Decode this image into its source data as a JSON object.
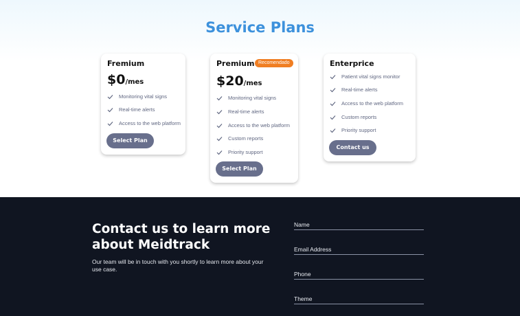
{
  "section_title": "Service Plans",
  "plans": [
    {
      "name": "Fremium",
      "price": "$0",
      "period": "/mes",
      "badge": "",
      "features": [
        "Monitoring vital signs",
        "Real-time alerts",
        "Access to the web platform"
      ],
      "button": "Select Plan"
    },
    {
      "name": "Premium",
      "price": "$20",
      "period": "/mes",
      "badge": "Recomendado",
      "features": [
        "Monitoring vital signs",
        "Real-time alerts",
        "Access to the web platform",
        "Custom reports",
        "Priority support"
      ],
      "button": "Select Plan"
    },
    {
      "name": "Enterprice",
      "price": "",
      "period": "",
      "badge": "",
      "features": [
        "Patient vital signs monitor",
        "Real-time alerts",
        "Access to the web platform",
        "Custom reports",
        "Priority support"
      ],
      "button": "Contact us"
    }
  ],
  "contact": {
    "title": "Contact us to learn more about Meidtrack",
    "subtitle": "Our team will be in touch with you shortly to learn more about your use case.",
    "fields": [
      {
        "label": "Name"
      },
      {
        "label": "Email Address"
      },
      {
        "label": "Phone"
      },
      {
        "label": "Theme"
      }
    ]
  },
  "colors": {
    "title_blue": "#3d91dc",
    "badge_orange": "#f07e22",
    "button_slate": "#686f8c",
    "footer_bg": "#101521"
  },
  "icons": {
    "feature_bullet": "check-icon"
  }
}
